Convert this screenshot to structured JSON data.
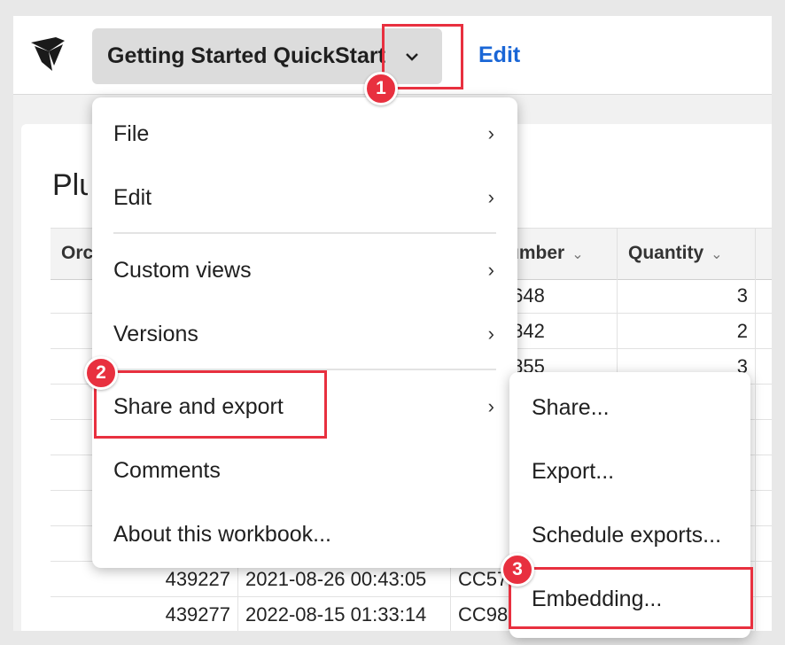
{
  "header": {
    "workbook_title": "Getting Started QuickStart",
    "edit_label": "Edit"
  },
  "panel": {
    "title": "Plu"
  },
  "table": {
    "columns": [
      "Order",
      "",
      "Card Number",
      "Quantity"
    ],
    "visible_header_fragments": [
      "Orc",
      "umber",
      "Quantity"
    ],
    "rows": [
      {
        "order": "",
        "date": "",
        "card": "75263648",
        "qty": "3"
      },
      {
        "order": "",
        "date": "",
        "card": "46663842",
        "qty": "2"
      },
      {
        "order": "",
        "date": "",
        "card": "56283855",
        "qty": "3"
      },
      {
        "order": "439227",
        "date": "2021-08-26 00:43:05",
        "card": "CC57",
        "qty": ""
      },
      {
        "order": "439277",
        "date": "2022-08-15 01:33:14",
        "card": "CC98",
        "qty": ""
      }
    ]
  },
  "menu": {
    "items": [
      {
        "label": "File",
        "has_submenu": true
      },
      {
        "label": "Edit",
        "has_submenu": true
      },
      {
        "label": "Custom views",
        "has_submenu": true
      },
      {
        "label": "Versions",
        "has_submenu": true
      },
      {
        "label": "Share and export",
        "has_submenu": true
      },
      {
        "label": "Comments",
        "has_submenu": false
      },
      {
        "label": "About this workbook...",
        "has_submenu": false
      }
    ],
    "arrow_glyph": "›"
  },
  "submenu": {
    "items": [
      "Share...",
      "Export...",
      "Schedule exports...",
      "Embedding..."
    ]
  },
  "callouts": [
    "1",
    "2",
    "3"
  ],
  "colors": {
    "accent": "#1a66d6",
    "callout": "#e8303f"
  },
  "icons": {
    "logo": "bird-logo-icon",
    "dropdown": "chevron-down-icon",
    "submenu": "chevron-right-icon"
  }
}
